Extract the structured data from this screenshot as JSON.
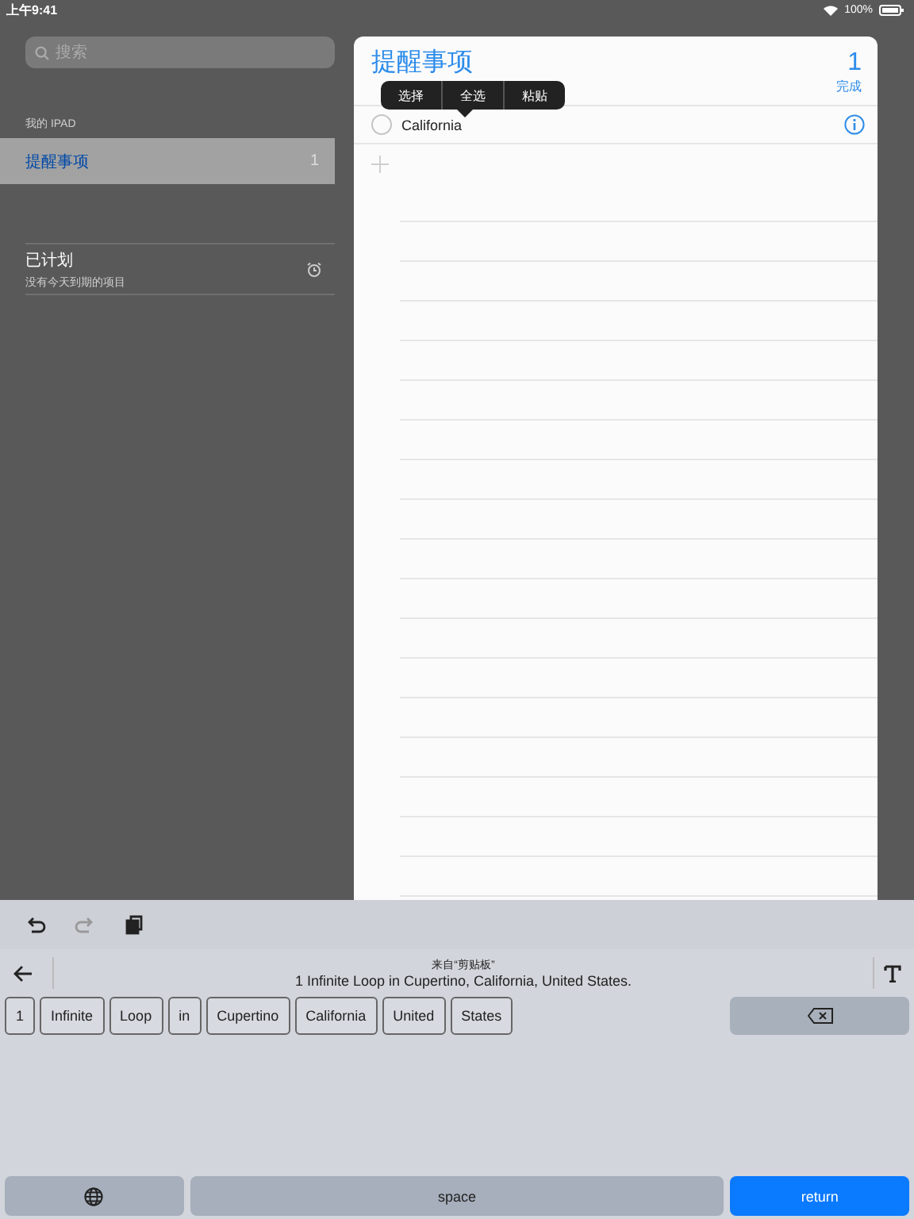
{
  "status_bar": {
    "time": "上午9:41",
    "battery": "100%"
  },
  "sidebar": {
    "search": {
      "placeholder": "搜索"
    },
    "section": "我的 IPAD",
    "lists": [
      {
        "name": "提醒事项",
        "count": "1",
        "selected": true
      }
    ],
    "scheduled": {
      "title": "已计划",
      "subtitle": "没有今天到期的项目"
    }
  },
  "reminders": {
    "title": "提醒事项",
    "count": "1",
    "count_label": "完成",
    "items": [
      {
        "text": "California",
        "completed": false
      }
    ],
    "edit_menu": [
      {
        "label": "选择"
      },
      {
        "label": "全选"
      },
      {
        "label": "粘贴"
      }
    ]
  },
  "keyboard": {
    "clipboard_source": "来自“剪贴板”",
    "clipboard_text": "1 Infinite Loop in Cupertino, California, United States.",
    "chips": [
      "1",
      "Infinite",
      "Loop",
      "in",
      "Cupertino",
      "California",
      "United",
      "States"
    ],
    "space": "space",
    "return": "return"
  }
}
